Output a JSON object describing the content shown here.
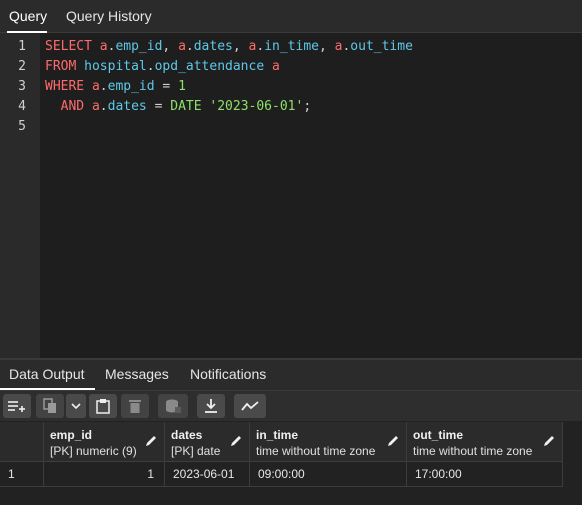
{
  "top_tabs": [
    "Query",
    "Query History"
  ],
  "editor": {
    "line_numbers": [
      "1",
      "2",
      "3",
      "4",
      "5"
    ]
  },
  "bottom_tabs": [
    "Data Output",
    "Messages",
    "Notifications"
  ],
  "toolbar": {
    "icons": [
      "add-row-icon",
      "copy-icon",
      "chevron-down-icon",
      "paste-icon",
      "delete-icon",
      "save-data-icon",
      "download-icon",
      "graph-icon"
    ]
  },
  "grid": {
    "columns": [
      {
        "name": "emp_id",
        "type": "[PK] numeric (9)"
      },
      {
        "name": "dates",
        "type": "[PK] date"
      },
      {
        "name": "in_time",
        "type": "time without time zone"
      },
      {
        "name": "out_time",
        "type": "time without time zone"
      }
    ],
    "rows": [
      {
        "num": "1",
        "emp_id": "1",
        "dates": "2023-06-01",
        "in_time": "09:00:00",
        "out_time": "17:00:00"
      }
    ]
  },
  "colors": {
    "keyword": "#ff6b6b",
    "identifier": "#5ec8e8",
    "literal": "#8ee06a"
  }
}
